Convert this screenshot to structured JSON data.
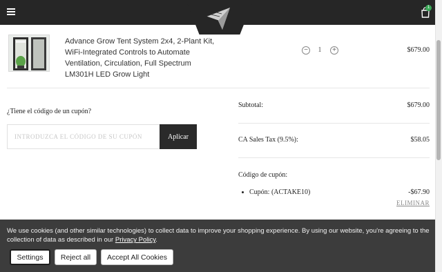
{
  "header": {
    "menu_icon": "hamburger-menu-icon",
    "logo_icon": "paper-plane-logo-icon",
    "cart_icon": "shopping-bag-icon",
    "cart_count": "1",
    "colors": {
      "background": "#262626",
      "badge": "#3aa857"
    }
  },
  "product": {
    "title": "Advance Grow Tent System 2x4, 2-Plant Kit, WiFi-Integrated Controls to Automate Ventilation, Circulation, Full Spectrum LM301H LED Grow Light",
    "quantity": "1",
    "price": "$679.00",
    "minus_icon": "minus-circle-icon",
    "plus_icon": "plus-circle-icon"
  },
  "coupon": {
    "question": "¿Tiene el código de un cupón?",
    "placeholder": "INTRODUZCA EL CÓDIGO DE SU CUPÓN",
    "apply_label": "Aplicar"
  },
  "summary": {
    "subtotal_label": "Subtotal:",
    "subtotal_value": "$679.00",
    "tax_label": "CA Sales Tax (9.5%):",
    "tax_value": "$58.05",
    "coupon_code_label": "Código de cupón:",
    "coupon_item_label": "Cupón: (ACTAKE10)",
    "coupon_item_value": "-$67.90",
    "remove_label": "ELIMINAR"
  },
  "cookie_banner": {
    "text": "We use cookies (and other similar technologies) to collect data to improve your shopping experience. By using our website, you're agreeing to the collection of data as described in our",
    "policy_link": "Privacy Policy",
    "policy_suffix": ".",
    "settings_label": "Settings",
    "reject_label": "Reject all",
    "accept_label": "Accept All Cookies",
    "colors": {
      "background": "#3c3c3c"
    }
  }
}
